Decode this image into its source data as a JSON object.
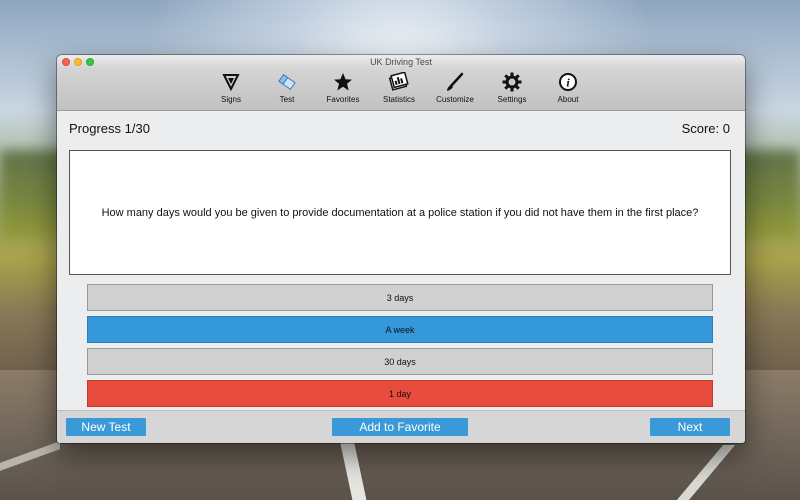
{
  "window": {
    "title": "UK Driving Test"
  },
  "toolbar": {
    "items": [
      {
        "label": "Signs",
        "icon": "signs-triangle-icon"
      },
      {
        "label": "Test",
        "icon": "test-eraser-icon"
      },
      {
        "label": "Favorites",
        "icon": "star-icon"
      },
      {
        "label": "Statistics",
        "icon": "statistics-icon"
      },
      {
        "label": "Customize",
        "icon": "brush-icon"
      },
      {
        "label": "Settings",
        "icon": "gear-icon"
      },
      {
        "label": "About",
        "icon": "info-icon"
      }
    ]
  },
  "quiz": {
    "progress": "Progress 1/30",
    "score": "Score: 0",
    "question": "How many days would you be given to provide documentation at a police station if you did not have them in the first place?",
    "answers": [
      {
        "text": "3 days",
        "state": "neutral"
      },
      {
        "text": "A week",
        "state": "correct"
      },
      {
        "text": "30 days",
        "state": "neutral"
      },
      {
        "text": "1 day",
        "state": "wrong"
      }
    ]
  },
  "bottom": {
    "new_test": "New Test",
    "add_favorite": "Add to Favorite",
    "next": "Next"
  },
  "colors": {
    "accent_blue": "#3a9ad9",
    "correct": "#3498db",
    "wrong": "#e74c3c",
    "neutral": "#d0d0d0"
  }
}
